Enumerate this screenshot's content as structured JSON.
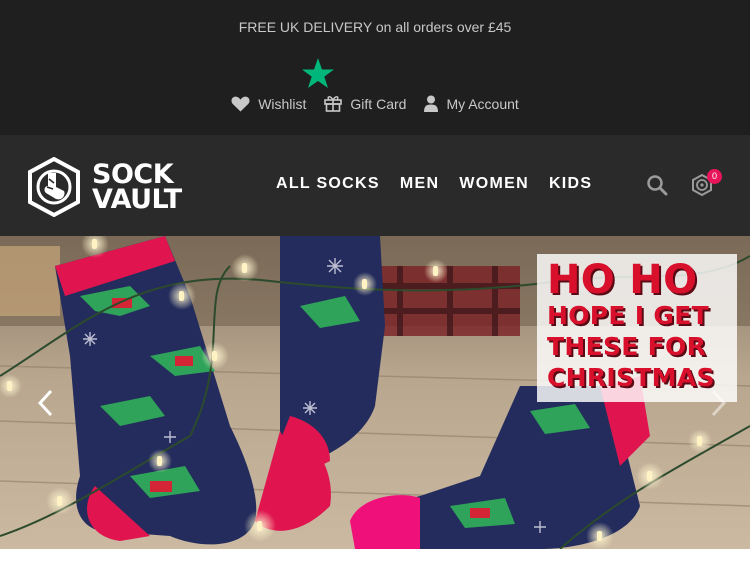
{
  "promo_bar": {
    "text": "FREE UK DELIVERY on all orders over £45"
  },
  "top_links": [
    {
      "label": "Wishlist",
      "icon": "heart-icon"
    },
    {
      "label": "Gift Card",
      "icon": "gift-icon"
    },
    {
      "label": "My Account",
      "icon": "user-icon"
    }
  ],
  "brand": {
    "line1": "SOCK",
    "line2": "VAULT"
  },
  "nav": {
    "items": [
      "ALL SOCKS",
      "MEN",
      "WOMEN",
      "KIDS"
    ]
  },
  "basket": {
    "count": "0"
  },
  "hero": {
    "slogan": [
      "HO HO",
      "HOPE I GET",
      "THESE FOR",
      "CHRISTMAS"
    ]
  },
  "colors": {
    "topbar": "#1f1f1f",
    "navbar": "#2a2a2a",
    "accent_pink": "#e8155b",
    "trustpilot_green": "#00b67a",
    "slogan_red": "#d8102c"
  }
}
